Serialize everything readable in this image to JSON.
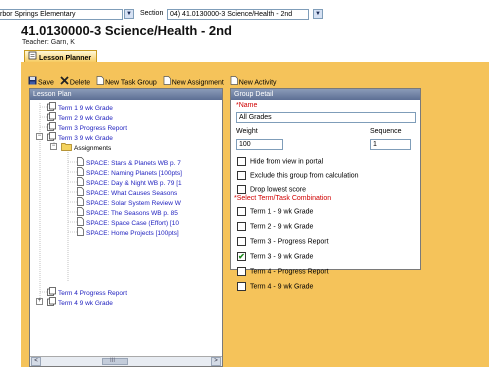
{
  "header": {
    "school_value": "rbor Springs Elementary",
    "section_label": "Section",
    "section_value": "04) 41.0130000-3 Science/Health - 2nd",
    "page_title": "41.0130000-3 Science/Health - 2nd",
    "teacher": "Teacher: Garn, K"
  },
  "tab": {
    "label": "Lesson Planner",
    "icon": "notebook-icon"
  },
  "toolbar": {
    "save": "Save",
    "delete": "Delete",
    "new_task_group": "New Task Group",
    "new_assignment": "New Assignment",
    "new_activity": "New Activity"
  },
  "lesson_plan": {
    "header": "Lesson Plan",
    "items": [
      {
        "label": "Term 1 9 wk Grade"
      },
      {
        "label": "Term 2 9 wk Grade"
      },
      {
        "label": "Term 3 Progress Report"
      },
      {
        "label": "Term 3 9 wk Grade"
      },
      {
        "label": "Assignments"
      },
      {
        "label": "SPACE: Stars & Planets WB p. 7"
      },
      {
        "label": "SPACE: Naming Planets [100pts]"
      },
      {
        "label": "SPACE: Day & Night WB p. 79 [1"
      },
      {
        "label": "SPACE: What Causes Seasons"
      },
      {
        "label": "SPACE: Solar System Review W"
      },
      {
        "label": "SPACE: The Seasons WB p. 85"
      },
      {
        "label": "SPACE: Space Case (Effort) [10"
      },
      {
        "label": "SPACE: Home Projects [100pts]"
      },
      {
        "label": "Term 4 Progress Report"
      },
      {
        "label": "Term 4 9 wk Grade"
      }
    ],
    "scroll_mid": "III"
  },
  "group_detail": {
    "header": "Group Detail",
    "name_label": "*Name",
    "name_value": "All Grades",
    "weight_label": "Weight",
    "weight_value": "100",
    "sequence_label": "Sequence",
    "sequence_value": "1",
    "options": [
      {
        "label": "Hide from view in portal",
        "checked": false
      },
      {
        "label": "Exclude this group from calculation",
        "checked": false
      },
      {
        "label": "Drop lowest score",
        "checked": false
      }
    ],
    "term_task_label": "*Select Term/Task Combination",
    "terms": [
      {
        "label": "Term 1 - 9 wk Grade",
        "checked": false
      },
      {
        "label": "Term 2 - 9 wk Grade",
        "checked": false
      },
      {
        "label": "Term 3 - Progress Report",
        "checked": false
      },
      {
        "label": "Term 3 - 9 wk Grade",
        "checked": true
      },
      {
        "label": "Term 4 - Progress Report",
        "checked": false
      },
      {
        "label": "Term 4 - 9 wk Grade",
        "checked": false
      }
    ],
    "check_mark": "✔"
  }
}
